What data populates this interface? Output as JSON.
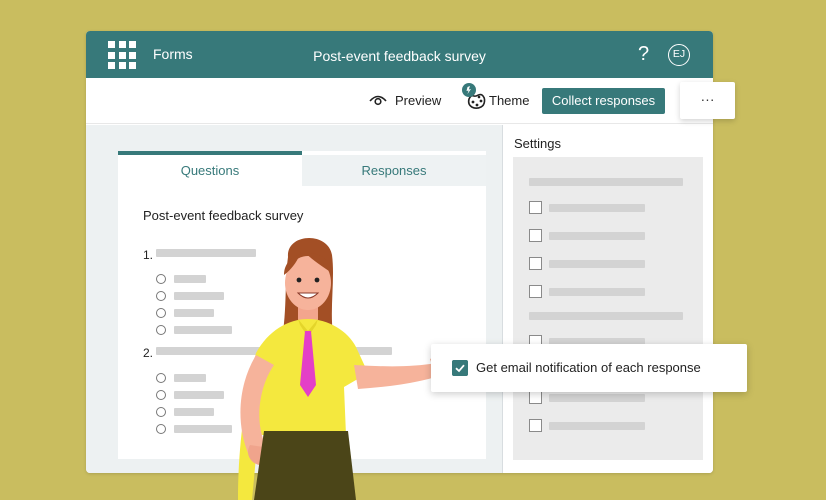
{
  "app": {
    "name": "Forms",
    "doc_title": "Post-event feedback survey",
    "help_label": "?",
    "avatar_initials": "EJ"
  },
  "toolbar": {
    "preview_label": "Preview",
    "theme_label": "Theme",
    "collect_label": "Collect responses",
    "more_label": "···"
  },
  "tabs": [
    {
      "label": "Questions",
      "active": true
    },
    {
      "label": "Responses",
      "active": false
    }
  ],
  "form": {
    "title": "Post-event feedback survey",
    "questions": [
      {
        "number": "1."
      },
      {
        "number": "2."
      }
    ]
  },
  "settings": {
    "title": "Settings",
    "notification_label": "Get email notification of each response",
    "notification_checked": true
  },
  "colors": {
    "background": "#c9bd5f",
    "accent": "#37797a",
    "panel": "#edf1f2",
    "placeholder": "#d3d3d3"
  },
  "icons": [
    "app-launcher-icon",
    "help-icon",
    "eye-icon",
    "palette-icon",
    "checkbox-icon",
    "radio-icon"
  ]
}
